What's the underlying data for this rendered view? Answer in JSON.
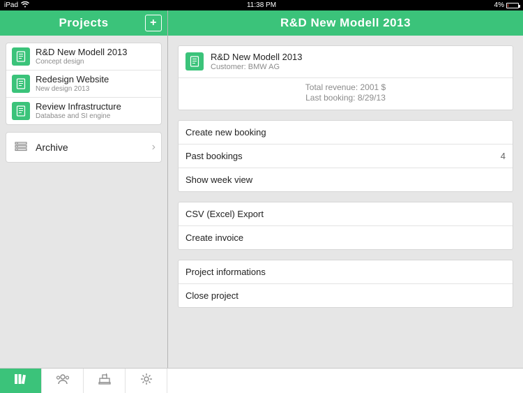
{
  "statusbar": {
    "device": "iPad",
    "time": "11:38 PM",
    "battery_pct": "4%"
  },
  "sidebar": {
    "title": "Projects",
    "add_label": "+",
    "projects": [
      {
        "title": "R&D New Modell 2013",
        "subtitle": "Concept design"
      },
      {
        "title": "Redesign Website",
        "subtitle": "New design 2013"
      },
      {
        "title": "Review Infrastructure",
        "subtitle": "Database and SI engine"
      }
    ],
    "archive_label": "Archive"
  },
  "main": {
    "title": "R&D New Modell 2013",
    "project": {
      "title": "R&D New Modell 2013",
      "customer": "Customer: BMW AG"
    },
    "summary": {
      "revenue": "Total revenue: 2001 $",
      "last_booking": "Last booking: 8/29/13"
    },
    "actions": {
      "create_booking": "Create new booking",
      "past_bookings": "Past bookings",
      "past_bookings_count": "4",
      "week_view": "Show week view",
      "csv_export": "CSV (Excel) Export",
      "create_invoice": "Create invoice",
      "project_info": "Project informations",
      "close_project": "Close project"
    }
  },
  "tabs": {
    "projects": "Projects",
    "customers": "Customers",
    "register": "Register",
    "settings": "Settings"
  }
}
